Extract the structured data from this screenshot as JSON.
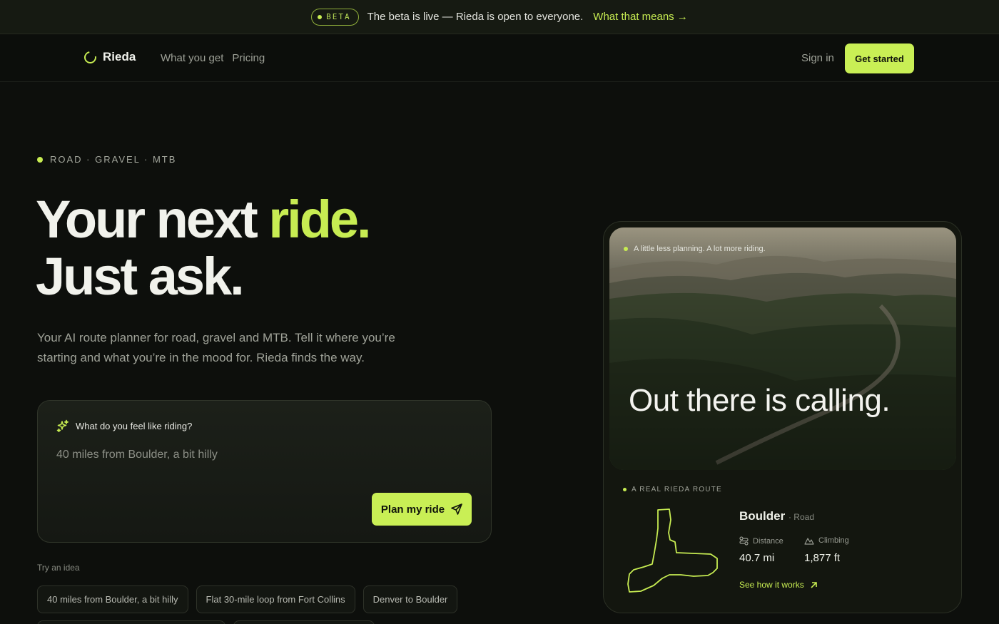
{
  "announcement": {
    "badge": "BETA",
    "text": "The beta is live — Rieda is open to everyone.",
    "link": "What that means →"
  },
  "nav": {
    "brand": "Rieda",
    "links": [
      "What you get",
      "Pricing"
    ],
    "signin": "Sign in",
    "cta": "Get started"
  },
  "hero": {
    "tag": "ROAD · GRAVEL · MTB",
    "headline_line1": "Your next ",
    "headline_accent": "ride.",
    "headline_line2": "Just ask.",
    "subtitle": "Your AI route planner for road, gravel and MTB. Tell it where you’re starting and what you’re in the mood for. Rieda finds the way."
  },
  "prompt": {
    "label": "What do you feel like riding?",
    "placeholder": "40 miles from Boulder, a bit hilly",
    "button": "Plan my ride"
  },
  "ideas": {
    "label": "Try an idea",
    "chips": [
      "40 miles from Boulder, a bit hilly",
      "Flat 30-mile loop from Fort Collins",
      "Denver to Boulder"
    ]
  },
  "route_card": {
    "caption": "A little less planning. A lot more riding.",
    "title": "Out there is calling.",
    "meta": "A REAL RIEDA ROUTE",
    "name": "Boulder",
    "type": "· Road",
    "distance_label": "Distance",
    "distance_value": "40.7 mi",
    "climbing_label": "Climbing",
    "climbing_value": "1,877 ft",
    "link": "See how it works"
  },
  "colors": {
    "accent": "#c7ec52",
    "background": "#0d0f0c"
  }
}
